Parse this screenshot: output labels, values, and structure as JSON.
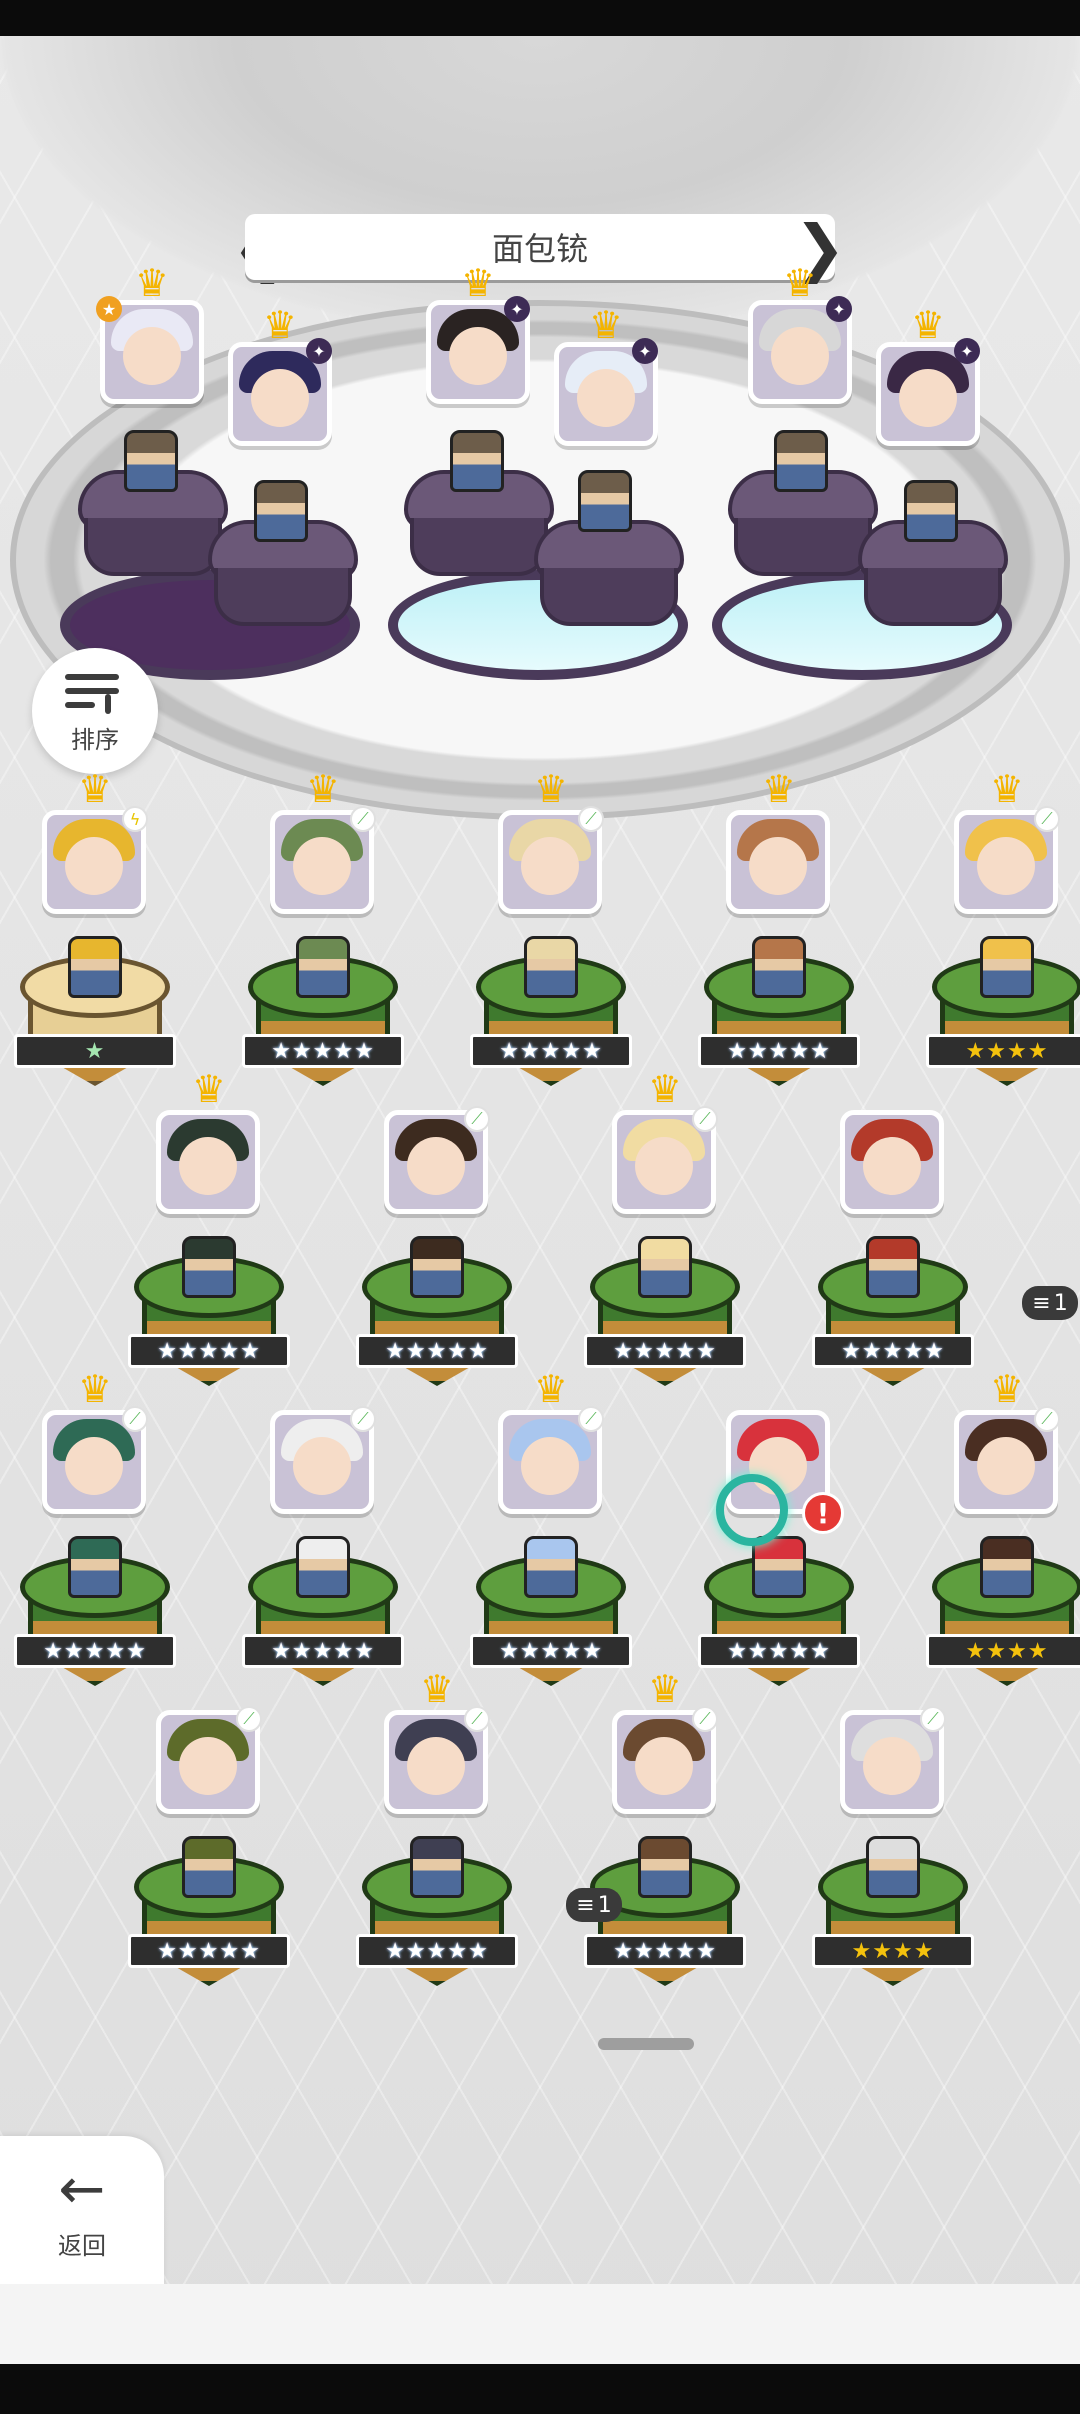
{
  "header": {
    "title": "面包铳"
  },
  "sort": {
    "label": "排序"
  },
  "back": {
    "label": "返回"
  },
  "stacks": {
    "a": "1",
    "b": "1"
  },
  "alert": {
    "text": "!"
  },
  "colors": {
    "accent_gold": "#f4b400",
    "island_green": "#5e9e3e",
    "alert_red": "#e53935"
  },
  "team_slots": [
    {
      "slot": 1,
      "crown": true,
      "badge": "star",
      "hair": "#e9e9f5"
    },
    {
      "slot": 2,
      "crown": true,
      "badge": "purple",
      "hair": "#2e2a5c"
    },
    {
      "slot": 3,
      "crown": true,
      "badge": "purple",
      "hair": "#2a2322"
    },
    {
      "slot": 4,
      "crown": true,
      "badge": "purple",
      "hair": "#e6edf7"
    },
    {
      "slot": 5,
      "crown": true,
      "badge": "purple",
      "hair": "#d7d7d7"
    },
    {
      "slot": 6,
      "crown": true,
      "badge": "purple",
      "hair": "#3a2845"
    }
  ],
  "roster": [
    {
      "crown": true,
      "badge": "yellow",
      "stars": "★",
      "star_style": "mint",
      "island": "sand",
      "hair": "#e7b62e"
    },
    {
      "crown": true,
      "badge": "green",
      "stars": "★★★★★",
      "star_style": "rainbow",
      "island": "green",
      "hair": "#6c8a52"
    },
    {
      "crown": true,
      "badge": "green",
      "stars": "★★★★★",
      "star_style": "rainbow",
      "island": "green",
      "hair": "#e9d7a6"
    },
    {
      "crown": true,
      "badge": "none",
      "stars": "★★★★★",
      "star_style": "rainbow",
      "island": "green",
      "hair": "#b5764a"
    },
    {
      "crown": true,
      "badge": "green",
      "stars": "★★★★",
      "star_style": "gold",
      "island": "green",
      "hair": "#f0c14b"
    },
    {
      "crown": true,
      "badge": "none",
      "stars": "★★★★★",
      "star_style": "rainbow",
      "island": "green",
      "hair": "#2b3a30"
    },
    {
      "crown": false,
      "badge": "green",
      "stars": "★★★★★",
      "star_style": "rainbow",
      "island": "green",
      "hair": "#3d2b1f"
    },
    {
      "crown": true,
      "badge": "green",
      "stars": "★★★★★",
      "star_style": "rainbow",
      "island": "green",
      "hair": "#f1dca2"
    },
    {
      "crown": false,
      "badge": "none",
      "stars": "★★★★★",
      "star_style": "rainbow",
      "island": "green",
      "hair": "#b33a2a"
    },
    {
      "crown": true,
      "badge": "green",
      "stars": "★★★★★",
      "star_style": "rainbow",
      "island": "green",
      "hair": "#2e6a55"
    },
    {
      "crown": false,
      "badge": "green",
      "stars": "★★★★★",
      "star_style": "rainbow",
      "island": "green",
      "hair": "#eeeeee"
    },
    {
      "crown": true,
      "badge": "green",
      "stars": "★★★★★",
      "star_style": "rainbow",
      "island": "green",
      "hair": "#a9c6ee"
    },
    {
      "crown": false,
      "badge": "none",
      "stars": "★★★★★",
      "star_style": "rainbow",
      "island": "green",
      "hair": "#d8323c"
    },
    {
      "crown": true,
      "badge": "green",
      "stars": "★★★★",
      "star_style": "gold",
      "island": "green",
      "hair": "#4a2e22"
    },
    {
      "crown": false,
      "badge": "green",
      "stars": "★★★★★",
      "star_style": "rainbow",
      "island": "green",
      "hair": "#5d6b2a"
    },
    {
      "crown": true,
      "badge": "green",
      "stars": "★★★★★",
      "star_style": "rainbow",
      "island": "green",
      "hair": "#3f3f52"
    },
    {
      "crown": true,
      "badge": "green",
      "stars": "★★★★★",
      "star_style": "rainbow",
      "island": "green",
      "hair": "#6b4a30"
    },
    {
      "crown": false,
      "badge": "green",
      "stars": "★★★★",
      "star_style": "gold",
      "island": "green",
      "hair": "#dedede"
    }
  ]
}
